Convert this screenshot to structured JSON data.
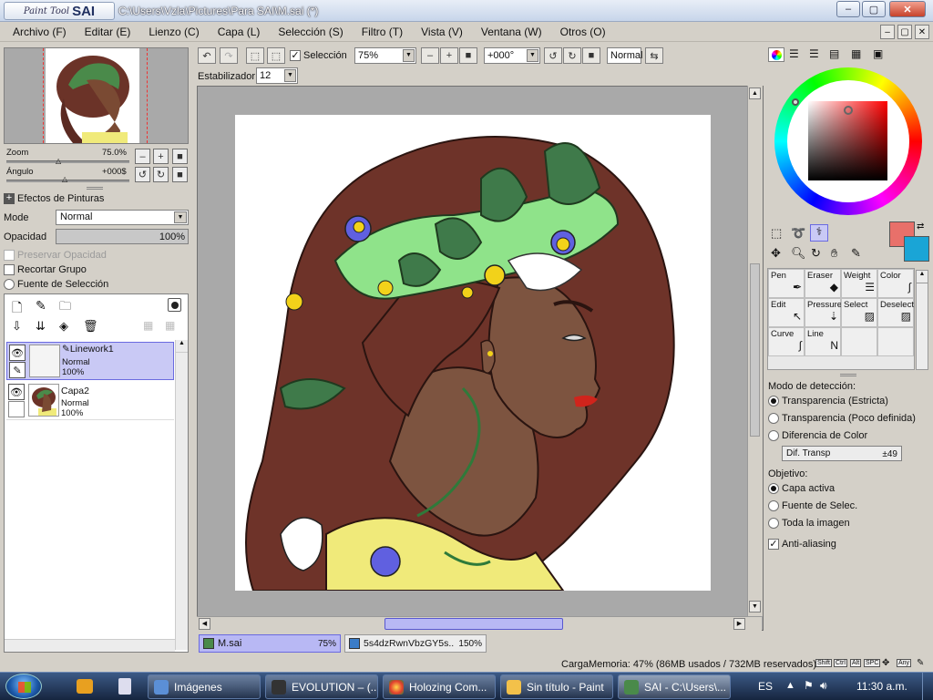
{
  "window": {
    "title": "C:\\Users\\Vzla\\Pictures\\Para SAI\\M.sai (*)",
    "logo_small": "Paint Tool",
    "logo_big": "SAI",
    "min": "–",
    "max": "▢",
    "close": "✕"
  },
  "menu": [
    "Archivo (F)",
    "Editar (E)",
    "Lienzo (C)",
    "Capa (L)",
    "Selección (S)",
    "Filtro (T)",
    "Vista (V)",
    "Ventana (W)",
    "Otros (O)"
  ],
  "navigator": {
    "zoom_label": "Zoom",
    "zoom_value": "75.0%",
    "angle_label": "Ángulo",
    "angle_value": "+000$"
  },
  "layer_props": {
    "effects_label": "Efectos de Pinturas",
    "mode_label": "Mode",
    "mode_value": "Normal",
    "opacity_label": "Opacidad",
    "opacity_value": "100%",
    "opacity_fraction": 1.0,
    "preserve_opacity": "Preservar Opacidad",
    "clip_group": "Recortar Grupo",
    "selection_source": "Fuente de Selección"
  },
  "layers": [
    {
      "name": "Linework1",
      "mode": "Normal",
      "opacity": "100%",
      "selected": true
    },
    {
      "name": "Capa2",
      "mode": "Normal",
      "opacity": "100%",
      "selected": false
    }
  ],
  "toolbar": {
    "selection_label": "Selección",
    "zoom": "75%",
    "angle": "+000°",
    "blend": "Normal",
    "stabilizer_label": "Estabilizador",
    "stabilizer_value": "12"
  },
  "tools": [
    {
      "label": "Pen",
      "icon": "pen-icon"
    },
    {
      "label": "Eraser",
      "icon": "eraser-icon"
    },
    {
      "label": "Weight",
      "icon": "weight-icon"
    },
    {
      "label": "Color",
      "icon": "color-icon"
    },
    {
      "label": "Edit",
      "icon": "edit-icon"
    },
    {
      "label": "Pressure",
      "icon": "pressure-icon"
    },
    {
      "label": "Select",
      "icon": "select-icon"
    },
    {
      "label": "Deselect",
      "icon": "deselect-icon"
    },
    {
      "label": "Curve",
      "icon": "curve-icon"
    },
    {
      "label": "Line",
      "icon": "line-icon"
    }
  ],
  "colors": {
    "primary": "#e8706a",
    "secondary": "#1aa5d6"
  },
  "detection": {
    "title": "Modo de detección:",
    "options": [
      "Transparencia (Estricta)",
      "Transparencia (Poco definida)",
      "Diferencia de Color"
    ],
    "selected": 0,
    "dif_label": "Dif. Transp",
    "dif_value": "±49",
    "target_title": "Objetivo:",
    "targets": [
      "Capa activa",
      "Fuente de Selec.",
      "Toda la imagen"
    ],
    "target_selected": 0,
    "antialias": "Anti-aliasing"
  },
  "doc_tabs": [
    {
      "name": "M.sai",
      "zoom": "75%",
      "active": true
    },
    {
      "name": "5s4dzRwnVbzGY5s...",
      "zoom": "150%",
      "active": false
    }
  ],
  "status": {
    "memory": "CargaMemoria: 47% (86MB usados / 732MB reservados)",
    "keys": [
      "Shift",
      "Ctrl",
      "Alt",
      "SPC",
      "Any"
    ]
  },
  "taskbar": {
    "items": [
      "Imágenes",
      "EVOLUTION – (...",
      "Holozing Com...",
      "Sin título - Paint",
      "SAI - C:\\Users\\..."
    ],
    "lang": "ES",
    "time": "11:30 a.m."
  }
}
